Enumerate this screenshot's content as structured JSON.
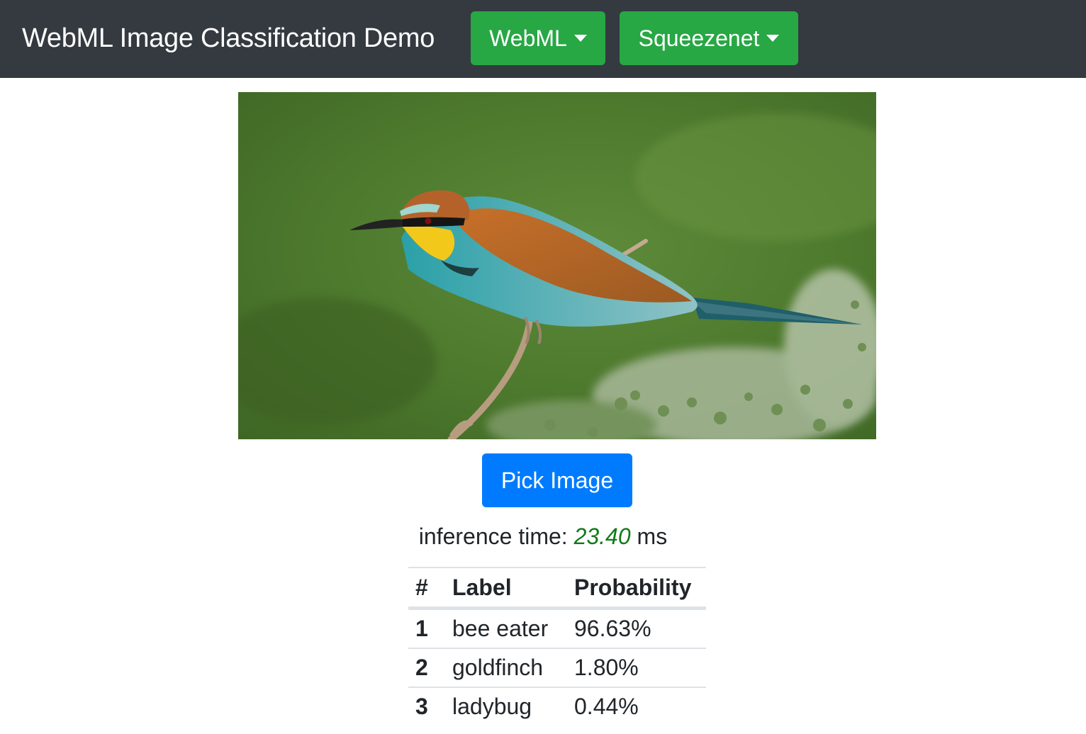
{
  "navbar": {
    "brand": "WebML Image Classification Demo",
    "backend_label": "WebML",
    "model_label": "Squeezenet",
    "background": "#343a40",
    "button_color": "#28a745"
  },
  "image": {
    "icon": "bird-photo"
  },
  "pick_button": {
    "label": "Pick Image",
    "color": "#007bff"
  },
  "inference": {
    "prefix": "inference time:",
    "value": "23.40",
    "unit": "ms",
    "value_color": "#117a18"
  },
  "results": {
    "headers": [
      "#",
      "Label",
      "Probability"
    ],
    "rows": [
      {
        "rank": "1",
        "label": "bee eater",
        "probability": "96.63%"
      },
      {
        "rank": "2",
        "label": "goldfinch",
        "probability": "1.80%"
      },
      {
        "rank": "3",
        "label": "ladybug",
        "probability": "0.44%"
      }
    ]
  }
}
